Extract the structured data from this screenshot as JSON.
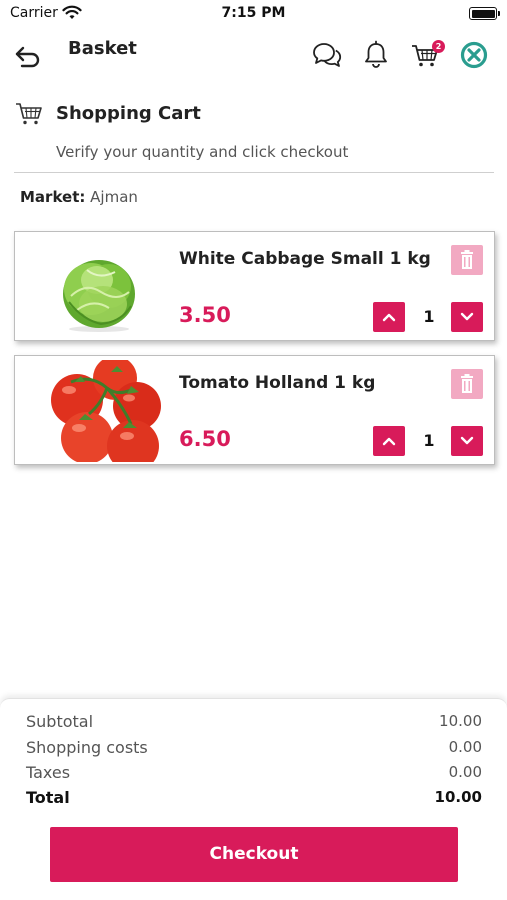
{
  "status_bar": {
    "carrier": "Carrier",
    "time": "7:15 PM"
  },
  "header": {
    "title": "Basket",
    "icons": [
      "back-arrow-icon",
      "chat-icon",
      "bell-icon",
      "cart-icon",
      "logout-icon"
    ],
    "cart_badge": "2"
  },
  "section": {
    "icon": "cart-icon",
    "title": "Shopping Cart",
    "subtitle": "Verify your quantity and click checkout"
  },
  "market": {
    "label": "Market:",
    "value": "Ajman"
  },
  "items": [
    {
      "name": "White Cabbage Small 1 kg",
      "price": "3.50",
      "quantity": "1",
      "image": "cabbage"
    },
    {
      "name": "Tomato Holland 1 kg",
      "price": "6.50",
      "quantity": "1",
      "image": "tomatoes"
    }
  ],
  "summary": {
    "subtotal_label": "Subtotal",
    "subtotal": "10.00",
    "shipping_label": "Shopping costs",
    "shipping": "0.00",
    "taxes_label": "Taxes",
    "taxes": "0.00",
    "total_label": "Total",
    "total": "10.00"
  },
  "checkout_label": "Checkout",
  "colors": {
    "accent": "#d81b5a",
    "accent_light": "#f2a9c2",
    "logout_teal": "#2a9d8f"
  }
}
